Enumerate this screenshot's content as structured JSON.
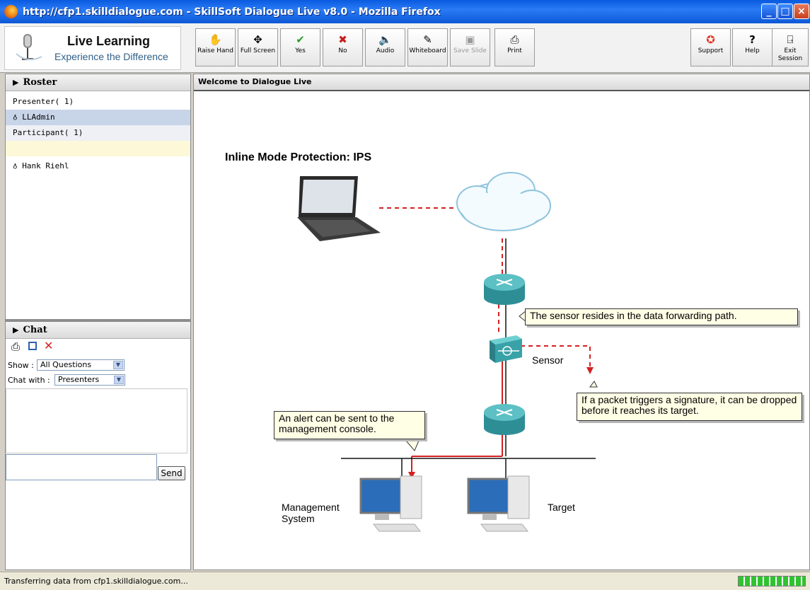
{
  "window": {
    "title": "http://cfp1.skilldialogue.com - SkillSoft Dialogue Live v8.0 - Mozilla Firefox"
  },
  "logo": {
    "line1": "Live Learning",
    "line2": "Experience the Difference"
  },
  "toolbar": {
    "raise_hand": "Raise Hand",
    "full_screen": "Full Screen",
    "yes": "Yes",
    "no": "No",
    "audio": "Audio",
    "whiteboard": "Whiteboard",
    "save_slide": "Save Slide",
    "print": "Print",
    "support": "Support",
    "help": "Help",
    "exit_session": "Exit Session"
  },
  "roster": {
    "title": "Roster",
    "presenter_group": "Presenter( 1)",
    "presenters": [
      "LLAdmin"
    ],
    "participant_group": "Participant( 1)",
    "participants": [
      "Hank Riehl"
    ]
  },
  "chat": {
    "title": "Chat",
    "show_label": "Show :",
    "show_value": "All Questions",
    "chat_with_label": "Chat with :",
    "chat_with_value": "Presenters",
    "send_label": "Send"
  },
  "main": {
    "header": "Welcome to Dialogue Live",
    "slide": {
      "title": "Inline Mode Protection: IPS",
      "callout_sensor": "The sensor resides in the data forwarding path.",
      "sensor_label": "Sensor",
      "callout_packet": "If a packet triggers a signature, it can be dropped before it reaches its target.",
      "callout_alert": "An alert can be sent to the management console.",
      "mgmt_label": "Management System",
      "target_label": "Target"
    }
  },
  "status": {
    "text": "Transferring data from cfp1.skilldialogue.com...",
    "progress_fraction": 1.0
  },
  "colors": {
    "accent_blue": "#0a5ae0",
    "router_teal": "#3aa6a6",
    "path_red": "#d42020"
  }
}
